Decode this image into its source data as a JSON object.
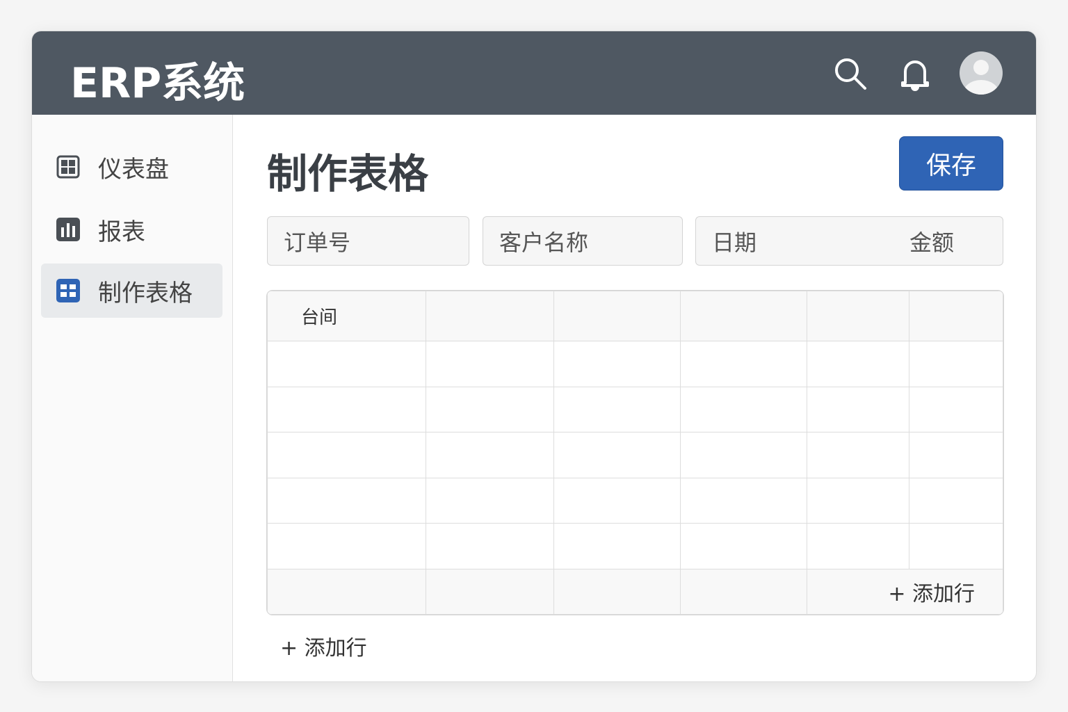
{
  "header": {
    "title": "ERP系统",
    "icons": [
      "search-icon",
      "bell-icon",
      "avatar-icon"
    ]
  },
  "sidebar": {
    "items": [
      {
        "label": "仪表盘",
        "icon": "dashboard-icon"
      },
      {
        "label": "报表",
        "icon": "bar-chart-icon"
      },
      {
        "label": "制作表格",
        "icon": "grid-icon",
        "active": true
      }
    ]
  },
  "main": {
    "title": "制作表格",
    "save_label": "保存",
    "fields": [
      "订单号",
      "客户名称",
      "日期",
      "金额"
    ],
    "table": {
      "header_first": "台间",
      "add_row_inline": "+  添加行"
    },
    "add_row": "+  添加行"
  },
  "colors": {
    "header": "#4f5862",
    "accent": "#2f64b5"
  }
}
